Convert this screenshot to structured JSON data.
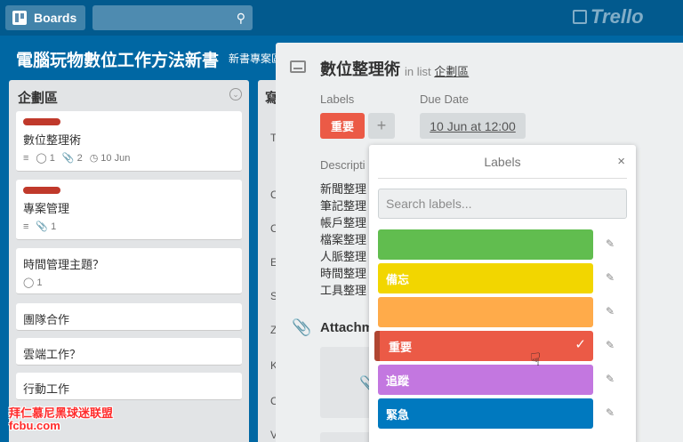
{
  "header": {
    "boards_label": "Boards",
    "search_placeholder": "",
    "logo_text": "Trello"
  },
  "board": {
    "title": "電腦玩物數位工作方法新書",
    "subtitle": "新書專案區"
  },
  "list": {
    "title": "企劃區",
    "cards": [
      {
        "title": "數位整理術",
        "has_label": true,
        "badges": {
          "desc": true,
          "comments": "1",
          "attachments": "2",
          "due": "10 Jun"
        }
      },
      {
        "title": "專案管理",
        "has_label": true,
        "badges": {
          "desc": true,
          "attachments": "1"
        }
      },
      {
        "title": "時間管理主題？",
        "badges": {
          "comments": "1"
        }
      },
      {
        "title": "團隊合作"
      },
      {
        "title": "雲端工作？"
      },
      {
        "title": "行動工作"
      }
    ]
  },
  "list2": {
    "title": "寫",
    "rows": [
      "T",
      "C",
      "C",
      "E",
      "S",
      "Z",
      "K",
      "C",
      "V"
    ]
  },
  "card_detail": {
    "title": "數位整理術",
    "in_list_prefix": "in list",
    "list_name": "企劃區",
    "labels_heading": "Labels",
    "label_chip": "重要",
    "add_label": "+",
    "due_heading": "Due Date",
    "due_value": "10 Jun at 12:00",
    "description_heading": "Descripti",
    "description_lines": [
      "新聞整理",
      "筆記整理",
      "帳戶整理",
      "檔案整理",
      "人脈整理",
      "時間整理",
      "工具整理"
    ],
    "attachments_heading": "Attachm"
  },
  "labels_popup": {
    "title": "Labels",
    "close": "×",
    "search_placeholder": "Search labels...",
    "labels": [
      {
        "name": "",
        "color": "#61bd4f"
      },
      {
        "name": "備忘",
        "color": "#f2d600"
      },
      {
        "name": "",
        "color": "#ffab4a"
      },
      {
        "name": "重要",
        "color": "#eb5a46",
        "selected": true
      },
      {
        "name": "追蹤",
        "color": "#c377e0"
      },
      {
        "name": "緊急",
        "color": "#0079bf"
      }
    ]
  },
  "watermark": {
    "line1": "拜仁慕尼黑球迷联盟",
    "line2": "fcbu.com"
  }
}
